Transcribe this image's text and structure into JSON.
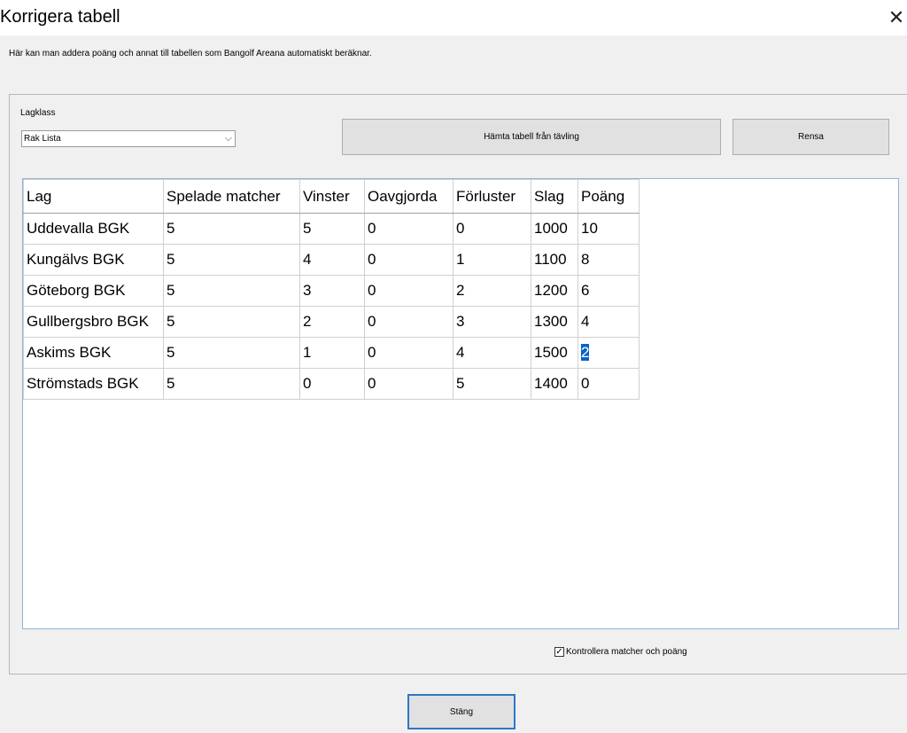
{
  "window": {
    "title": "Korrigera tabell",
    "close_glyph": "✕"
  },
  "description": "Här kan man addera poäng och annat till tabellen som Bangolf Areana automatiskt beräknar.",
  "lagklass": {
    "label": "Lagklass",
    "selected": "Rak Lista",
    "chevron": "⌵"
  },
  "buttons": {
    "hamta": "Hämta tabell från tävling",
    "rensa": "Rensa",
    "stang": "Stäng"
  },
  "table": {
    "headers": [
      "Lag",
      "Spelade matcher",
      "Vinster",
      "Oavgjorda",
      "Förluster",
      "Slag",
      "Poäng"
    ],
    "rows": [
      [
        "Uddevalla BGK",
        "5",
        "5",
        "0",
        "0",
        "1000",
        "10"
      ],
      [
        "Kungälvs BGK",
        "5",
        "4",
        "0",
        "1",
        "1100",
        "8"
      ],
      [
        "Göteborg BGK",
        "5",
        "3",
        "0",
        "2",
        "1200",
        "6"
      ],
      [
        "Gullbergsbro BGK",
        "5",
        "2",
        "0",
        "3",
        "1300",
        "4"
      ],
      [
        "Askims BGK",
        "5",
        "1",
        "0",
        "4",
        "1500",
        "2"
      ],
      [
        "Strömstads BGK",
        "5",
        "0",
        "0",
        "5",
        "1400",
        "0"
      ]
    ],
    "selected_cell": {
      "row": 4,
      "col": 6
    }
  },
  "checkbox": {
    "label": "Kontrollera matcher och poäng",
    "checked": true,
    "check_glyph": "✓"
  },
  "colors": {
    "selection": "#0a64c8",
    "focus_border": "#2b78c8"
  }
}
